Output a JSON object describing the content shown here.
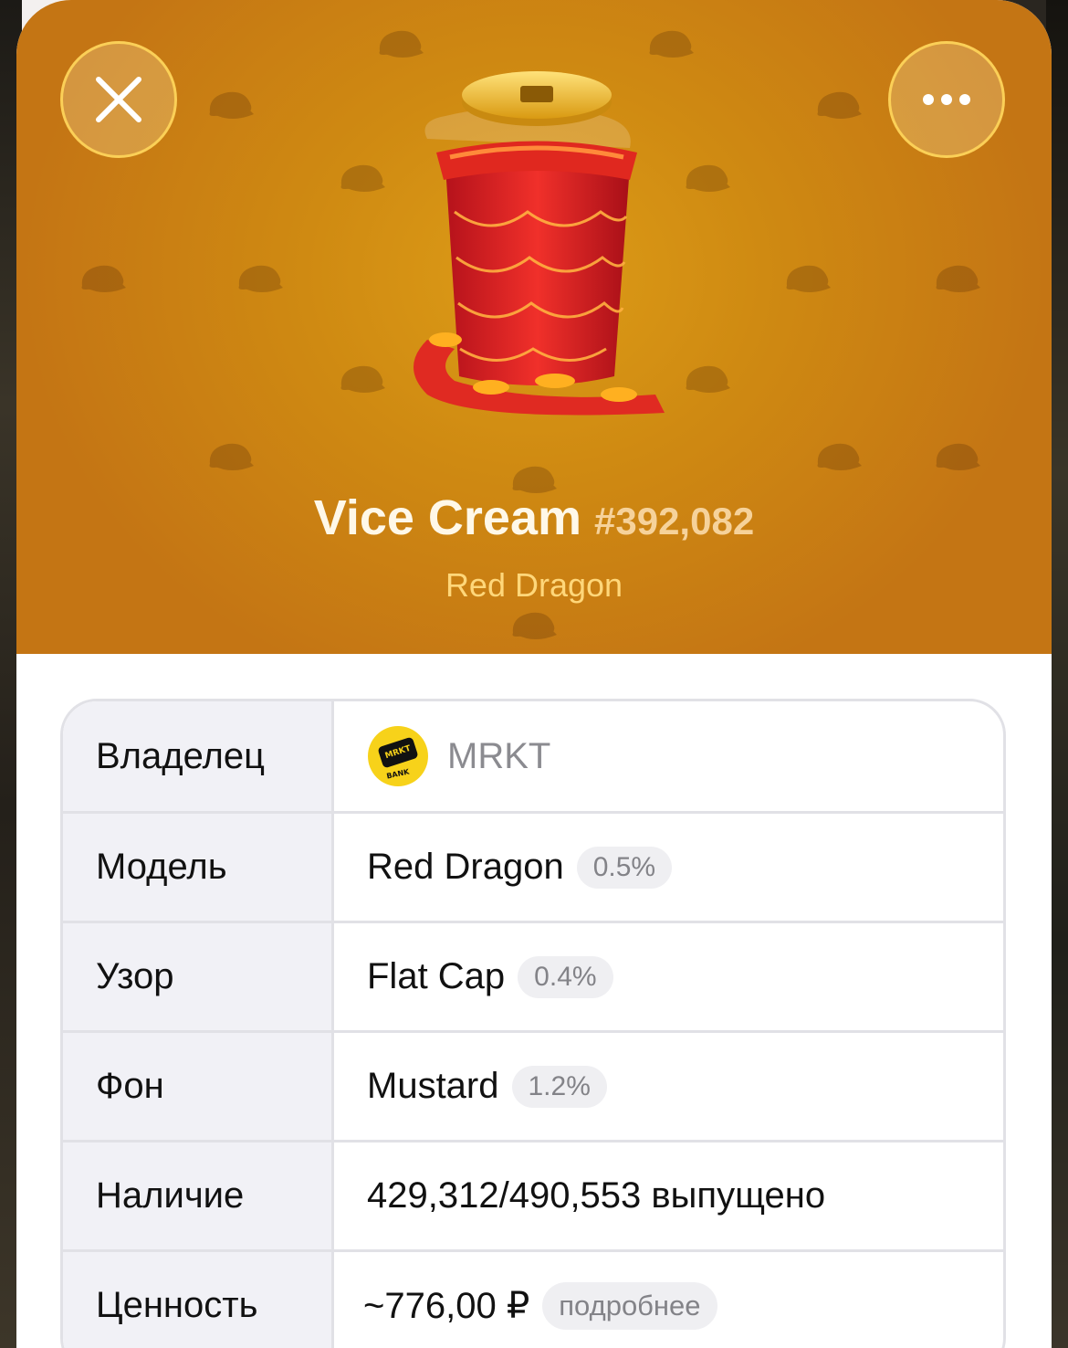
{
  "header": {
    "close_icon": "close-icon",
    "more_icon": "more-dots-icon"
  },
  "gift": {
    "name": "Vice Cream",
    "number": "#392,082",
    "subtitle": "Red Dragon",
    "background_color": "#D08A12",
    "pattern_icon": "flat-cap-icon",
    "image": "red-dragon-cup-illustration"
  },
  "details": {
    "owner": {
      "label": "Владелец",
      "value": "MRKT",
      "avatar_text_top": "MRKT",
      "avatar_text_bottom": "BANK"
    },
    "model": {
      "label": "Модель",
      "value": "Red Dragon",
      "rarity": "0.5%"
    },
    "pattern": {
      "label": "Узор",
      "value": "Flat Cap",
      "rarity": "0.4%"
    },
    "backdrop": {
      "label": "Фон",
      "value": "Mustard",
      "rarity": "1.2%"
    },
    "availability": {
      "label": "Наличие",
      "value": "429,312/490,553 выпущено"
    },
    "value": {
      "label": "Ценность",
      "value": "~776,00 ₽",
      "more_label": "подробнее"
    }
  },
  "colors": {
    "accent_gold": "#FFD77A",
    "pill_bg": "#EFEFF2",
    "pill_text": "#838388"
  }
}
